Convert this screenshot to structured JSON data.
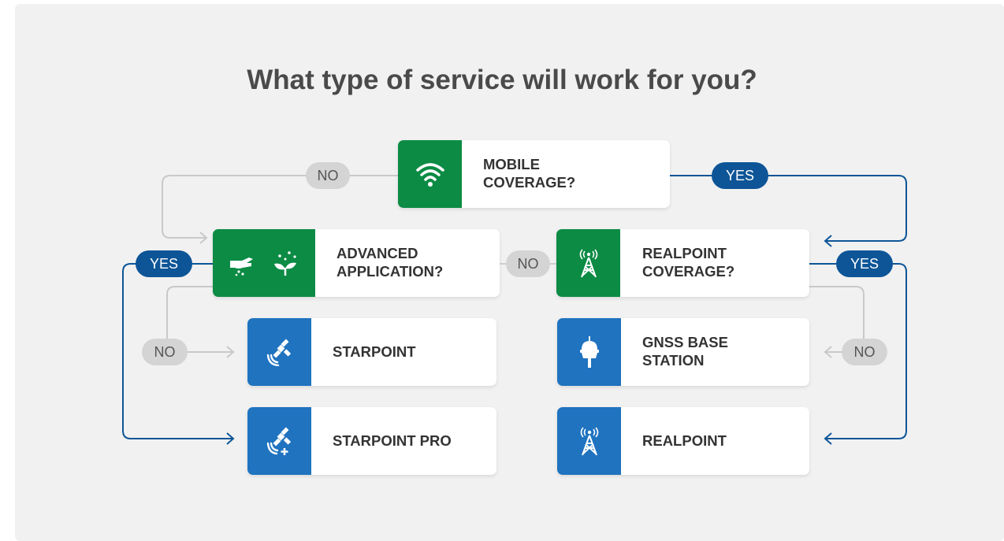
{
  "title": "What type of service will work for you?",
  "colors": {
    "green": "#0c8b44",
    "blue": "#1f73bf",
    "yes_pill": "#0d5597",
    "no_pill": "#d4d4d4",
    "yes_line": "#0d5597",
    "no_line": "#c9c9c9"
  },
  "nodes": {
    "mobile": {
      "label": "MOBILE\nCOVERAGE?",
      "icon": "wifi-icon"
    },
    "advanced": {
      "label": "ADVANCED\nAPPLICATION?",
      "icons": [
        "hand-spreading-icon",
        "seedling-icon"
      ]
    },
    "realpoint_cov": {
      "label": "REALPOINT\nCOVERAGE?",
      "icon": "radio-tower-icon"
    },
    "starpoint": {
      "label": "STARPOINT",
      "icon": "satellite-icon"
    },
    "gnss": {
      "label": "GNSS BASE\nSTATION",
      "icon": "gnss-receiver-icon"
    },
    "starpoint_pro": {
      "label": "STARPOINT PRO",
      "icon": "satellite-plus-icon"
    },
    "realpoint": {
      "label": "REALPOINT",
      "icon": "radio-tower-icon"
    }
  },
  "pills": {
    "mobile_no": "NO",
    "mobile_yes": "YES",
    "advanced_yes": "YES",
    "realpoint_no": "NO",
    "realpoint_yes": "YES",
    "advanced_no": "NO",
    "realpoint_cov_no": "NO"
  }
}
